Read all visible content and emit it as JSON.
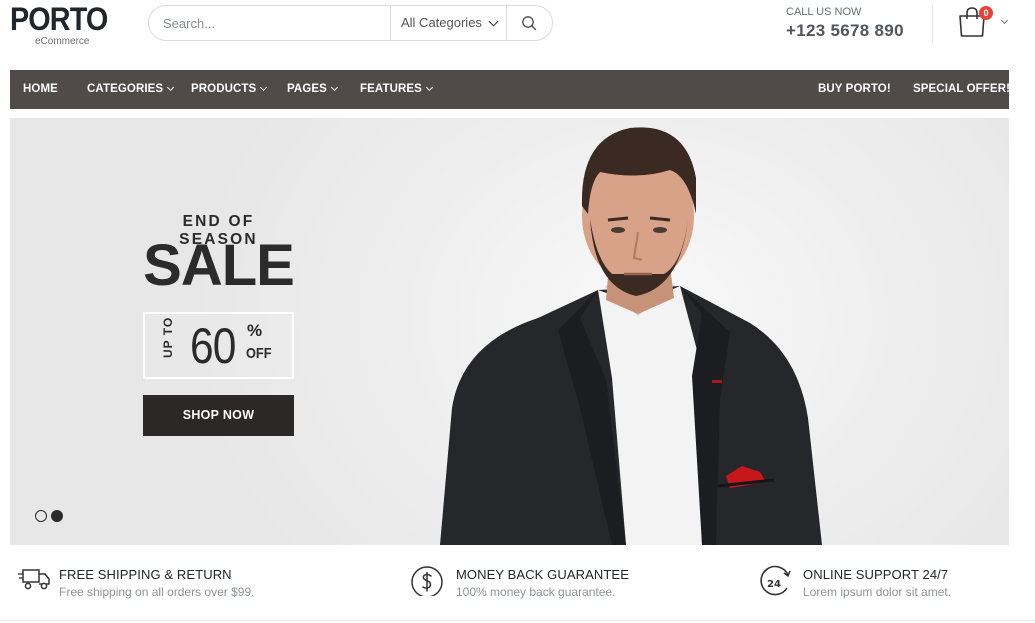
{
  "header": {
    "logo_main": "PORTO",
    "logo_sub": "eCommerce",
    "search": {
      "placeholder": "Search...",
      "category": "All Categories"
    },
    "call_label": "CALL US NOW",
    "phone": "+123 5678 890",
    "cart_count": "0"
  },
  "nav": {
    "items": [
      {
        "label": "HOME"
      },
      {
        "label": "CATEGORIES"
      },
      {
        "label": "PRODUCTS"
      },
      {
        "label": "PAGES"
      },
      {
        "label": "FEATURES"
      }
    ],
    "right_items": [
      {
        "label": "BUY PORTO!"
      },
      {
        "label": "SPECIAL OFFER!"
      }
    ]
  },
  "hero": {
    "eyebrow": "END OF SEASON",
    "title": "SALE",
    "promo_upto": "UP TO",
    "promo_number": "60",
    "promo_percent": "%",
    "promo_off": "OFF",
    "button": "SHOP NOW",
    "slides_count": 2,
    "active_slide": 2
  },
  "features": [
    {
      "icon": "truck-icon",
      "title": "FREE SHIPPING & RETURN",
      "subtitle": "Free shipping on all orders over $99."
    },
    {
      "icon": "dollar-circle-icon",
      "title": "MONEY BACK GUARANTEE",
      "subtitle": "100% money back guarantee."
    },
    {
      "icon": "support-24-icon",
      "title": "ONLINE SUPPORT 24/7",
      "subtitle": "Lorem ipsum dolor sit amet."
    }
  ],
  "colors": {
    "nav_bg": "#504a49",
    "button_bg": "#2c2828",
    "badge": "#e8403a",
    "hero_bg": "#eeeeee"
  }
}
